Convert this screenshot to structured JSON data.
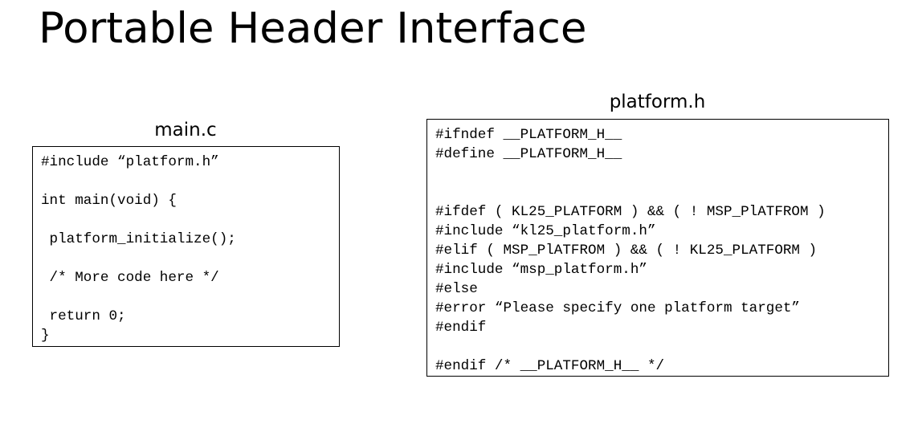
{
  "slide": {
    "title": "Portable Header Interface"
  },
  "main_panel": {
    "filename": "main.c",
    "code_lines": [
      "#include “platform.h”",
      "",
      "int main(void) {",
      "",
      " platform_initialize();",
      "",
      " /* More code here */",
      "",
      " return 0;",
      "}"
    ]
  },
  "platform_panel": {
    "filename": "platform.h",
    "code_lines": [
      "#ifndef __PLATFORM_H__",
      "#define __PLATFORM_H__",
      "",
      "",
      "#ifdef ( KL25_PLATFORM ) && ( ! MSP_PlATFROM )",
      "#include “kl25_platform.h”",
      "#elif ( MSP_PlATFROM ) && ( ! KL25_PLATFORM )",
      "#include “msp_platform.h”",
      "#else",
      "#error “Please specify one platform target”",
      "#endif",
      "",
      "#endif /* __PLATFORM_H__ */"
    ]
  }
}
